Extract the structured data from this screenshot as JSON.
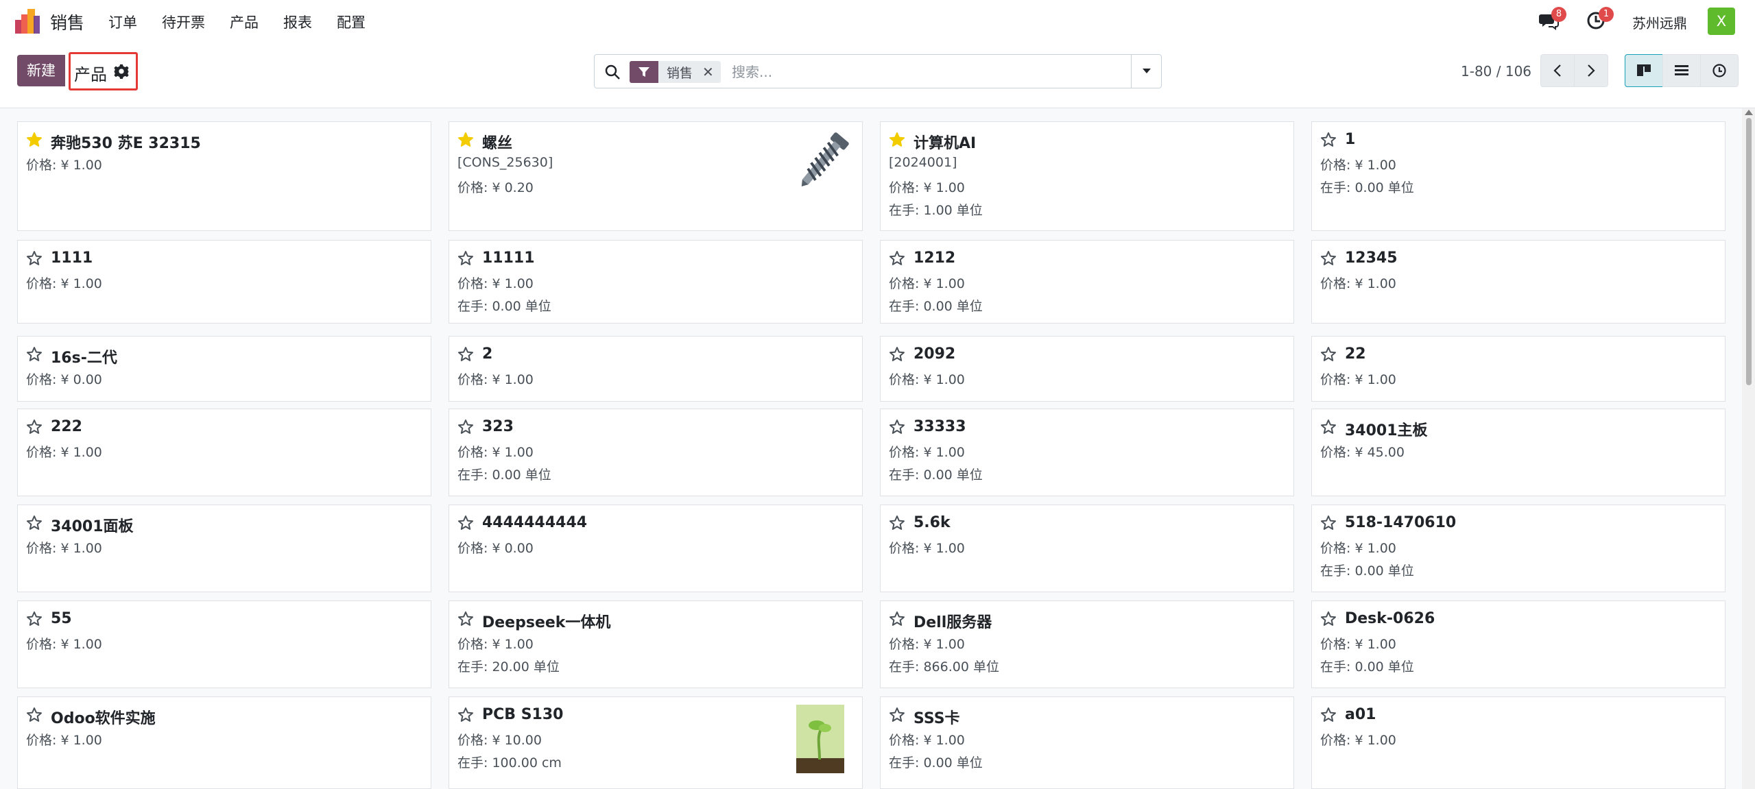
{
  "navbar": {
    "app_name": "销售",
    "menu": [
      "订单",
      "待开票",
      "产品",
      "报表",
      "配置"
    ],
    "messages_count": "8",
    "activities_count": "1",
    "company": "苏州远鼎",
    "avatar_letter": "X"
  },
  "control": {
    "new_label": "新建",
    "breadcrumb": "产品",
    "facet_label": "销售",
    "search_placeholder": "搜索...",
    "pager": "1-80 / 106"
  },
  "colors": {
    "brand": "#714b67",
    "favorite_star": "#f3cc00",
    "highlight_border": "#e53935"
  },
  "products": [
    {
      "name": "奔驰530 苏E 32315",
      "favorite": true,
      "lines": [
        "价格: ¥ 1.00"
      ]
    },
    {
      "name": "螺丝",
      "favorite": true,
      "lines": [
        "[CONS_25630]",
        "价格: ¥ 0.20"
      ],
      "image": "screw-image"
    },
    {
      "name": "计算机AI",
      "favorite": true,
      "lines": [
        "[2024001]",
        "价格: ¥ 1.00",
        "在手:   1.00 单位"
      ]
    },
    {
      "name": "1",
      "favorite": false,
      "lines": [
        "价格: ¥ 1.00",
        "在手:   0.00 单位"
      ]
    },
    {
      "name": "1111",
      "favorite": false,
      "lines": [
        "价格: ¥ 1.00"
      ]
    },
    {
      "name": "11111",
      "favorite": false,
      "lines": [
        "价格: ¥ 1.00",
        "在手:   0.00 单位"
      ]
    },
    {
      "name": "1212",
      "favorite": false,
      "lines": [
        "价格: ¥ 1.00",
        "在手:   0.00 单位"
      ]
    },
    {
      "name": "12345",
      "favorite": false,
      "lines": [
        "价格: ¥ 1.00"
      ]
    },
    {
      "name": "16s-二代",
      "favorite": false,
      "lines": [
        "价格: ¥ 0.00"
      ]
    },
    {
      "name": "2",
      "favorite": false,
      "lines": [
        "价格: ¥ 1.00"
      ]
    },
    {
      "name": "2092",
      "favorite": false,
      "lines": [
        "价格: ¥ 1.00"
      ]
    },
    {
      "name": "22",
      "favorite": false,
      "lines": [
        "价格: ¥ 1.00"
      ]
    },
    {
      "name": "222",
      "favorite": false,
      "lines": [
        "价格: ¥ 1.00"
      ]
    },
    {
      "name": "323",
      "favorite": false,
      "lines": [
        "价格: ¥ 1.00",
        "在手:   0.00 单位"
      ]
    },
    {
      "name": "33333",
      "favorite": false,
      "lines": [
        "价格: ¥ 1.00",
        "在手:   0.00 单位"
      ]
    },
    {
      "name": "34001主板",
      "favorite": false,
      "lines": [
        "价格: ¥ 45.00"
      ]
    },
    {
      "name": "34001面板",
      "favorite": false,
      "lines": [
        "价格: ¥ 1.00"
      ]
    },
    {
      "name": "4444444444",
      "favorite": false,
      "lines": [
        "价格: ¥ 0.00"
      ]
    },
    {
      "name": "5.6k",
      "favorite": false,
      "lines": [
        "价格: ¥ 1.00"
      ]
    },
    {
      "name": "518-1470610",
      "favorite": false,
      "lines": [
        "价格: ¥ 1.00",
        "在手:   0.00 单位"
      ]
    },
    {
      "name": "55",
      "favorite": false,
      "lines": [
        "价格: ¥ 1.00"
      ]
    },
    {
      "name": "Deepseek一体机",
      "favorite": false,
      "lines": [
        "价格: ¥ 1.00",
        "在手:   20.00 单位"
      ]
    },
    {
      "name": "Dell服务器",
      "favorite": false,
      "lines": [
        "价格: ¥ 1.00",
        "在手:   866.00 单位"
      ]
    },
    {
      "name": "Desk-0626",
      "favorite": false,
      "lines": [
        "价格: ¥ 1.00",
        "在手:   0.00 单位"
      ]
    },
    {
      "name": "Odoo软件实施",
      "favorite": false,
      "lines": [
        "价格: ¥ 1.00"
      ]
    },
    {
      "name": "PCB S130",
      "favorite": false,
      "lines": [
        "价格: ¥ 10.00",
        "在手:   100.00 cm"
      ],
      "image": "sprout-image"
    },
    {
      "name": "SSS卡",
      "favorite": false,
      "lines": [
        "价格: ¥ 1.00",
        "在手:   0.00 单位"
      ]
    },
    {
      "name": "a01",
      "favorite": false,
      "lines": [
        "价格: ¥ 1.00"
      ]
    }
  ]
}
